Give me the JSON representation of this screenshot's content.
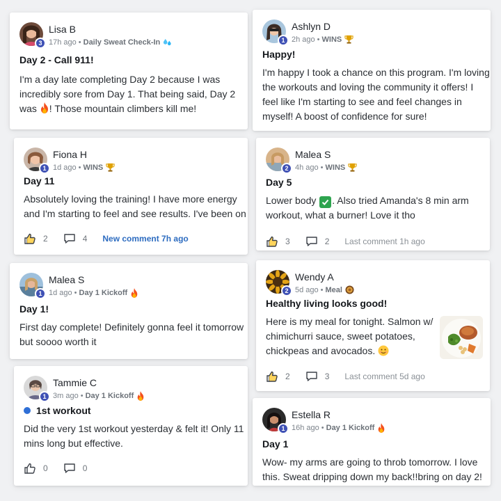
{
  "posts": [
    {
      "name": "Lisa B",
      "level": "3",
      "time": "17h ago",
      "category": "Daily Sweat Check-In",
      "category_icon": "droplets-icon",
      "title": "Day 2 - Call 911!",
      "body_lines": [
        "I'm a day late completing Day 2 because I was",
        "incredibly sore from Day 1. That being said, Day 2",
        "was",
        "! Those mountain climbers kill me!"
      ]
    },
    {
      "name": "Fiona H",
      "level": "1",
      "time": "1d ago",
      "category": "WINS",
      "category_icon": "trophy-icon",
      "title": "Day 11",
      "body_lines": [
        "Absolutely loving the training! I have more energy",
        "and I'm starting to feel and see results. I've been on"
      ],
      "likes": "2",
      "comments": "4",
      "comment_status": "New comment 7h ago"
    },
    {
      "name": "Malea S",
      "level": "1",
      "time": "1d ago",
      "category": "Day 1 Kickoff",
      "category_icon": "fire-icon",
      "title": "Day 1!",
      "body_lines": [
        "First day complete! Definitely gonna feel it tomorrow",
        "but soooo worth it"
      ]
    },
    {
      "name": "Tammie C",
      "level": "1",
      "time": "3m ago",
      "category": "Day 1 Kickoff",
      "category_icon": "fire-icon",
      "title": "1st workout",
      "body_lines": [
        "Did the very 1st workout yesterday & felt it! Only 11",
        "mins long but effective."
      ],
      "likes": "0",
      "comments": "0"
    },
    {
      "name": "Ashlyn D",
      "level": "1",
      "time": "2h ago",
      "category": "WINS",
      "category_icon": "trophy-icon",
      "title": "Happy!",
      "body_lines": [
        "I'm happy I took a chance on this program. I'm loving",
        "the workouts and loving the community it offers! I",
        "feel like I'm starting to see and feel changes in",
        "myself! A boost of confidence for sure!"
      ]
    },
    {
      "name": "Malea S",
      "level": "2",
      "time": "4h ago",
      "category": "WINS",
      "category_icon": "trophy-icon",
      "title": "Day 5",
      "body_lines": [
        "Lower body",
        ". Also tried Amanda's 8 min arm",
        "workout, what a burner! Love it tho"
      ],
      "likes": "3",
      "comments": "2",
      "comment_status": "Last comment 1h ago"
    },
    {
      "name": "Wendy A",
      "level": "2",
      "time": "5d ago",
      "category": "Meal",
      "category_icon": "plate-icon",
      "title": "Healthy living looks good!",
      "body_lines": [
        "Here is my meal for tonight. Salmon w/",
        "chimichurri sauce, sweet potatoes,",
        "chickpeas and avocados."
      ],
      "likes": "2",
      "comments": "3",
      "comment_status": "Last comment 5d ago"
    },
    {
      "name": "Estella R",
      "level": "1",
      "time": "16h ago",
      "category": "Day 1 Kickoff",
      "category_icon": "fire-icon",
      "title": "Day 1",
      "body_lines": [
        "Wow- my arms are going to throb tomorrow. I love",
        "this. Sweat dripping down my back!!bring on day 2!"
      ]
    }
  ],
  "colors": {
    "level_badge": "#3f51b5",
    "new_comment": "#2d6cc0",
    "check": "#2ea44f"
  }
}
